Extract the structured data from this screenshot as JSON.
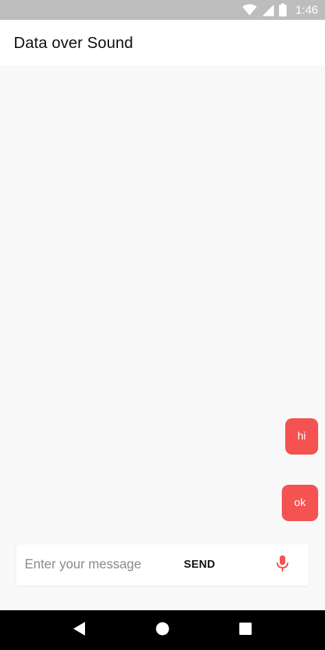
{
  "status_bar": {
    "time": "1:46",
    "icons": [
      "wifi-icon",
      "signal-icon",
      "battery-icon"
    ]
  },
  "app_bar": {
    "title": "Data over Sound"
  },
  "messages": [
    {
      "text": "hi"
    },
    {
      "text": "ok"
    }
  ],
  "composer": {
    "placeholder": "Enter your message",
    "value": "",
    "send_label": "SEND",
    "mic_icon": "microphone-icon"
  },
  "navigation": {
    "icons": [
      "back-icon",
      "home-icon",
      "recents-icon"
    ]
  },
  "colors": {
    "accent": "#f55252",
    "status_bar": "#bdbdbd",
    "app_bar": "#ffffff",
    "background": "#f9f9f9",
    "nav_bar": "#000000"
  }
}
